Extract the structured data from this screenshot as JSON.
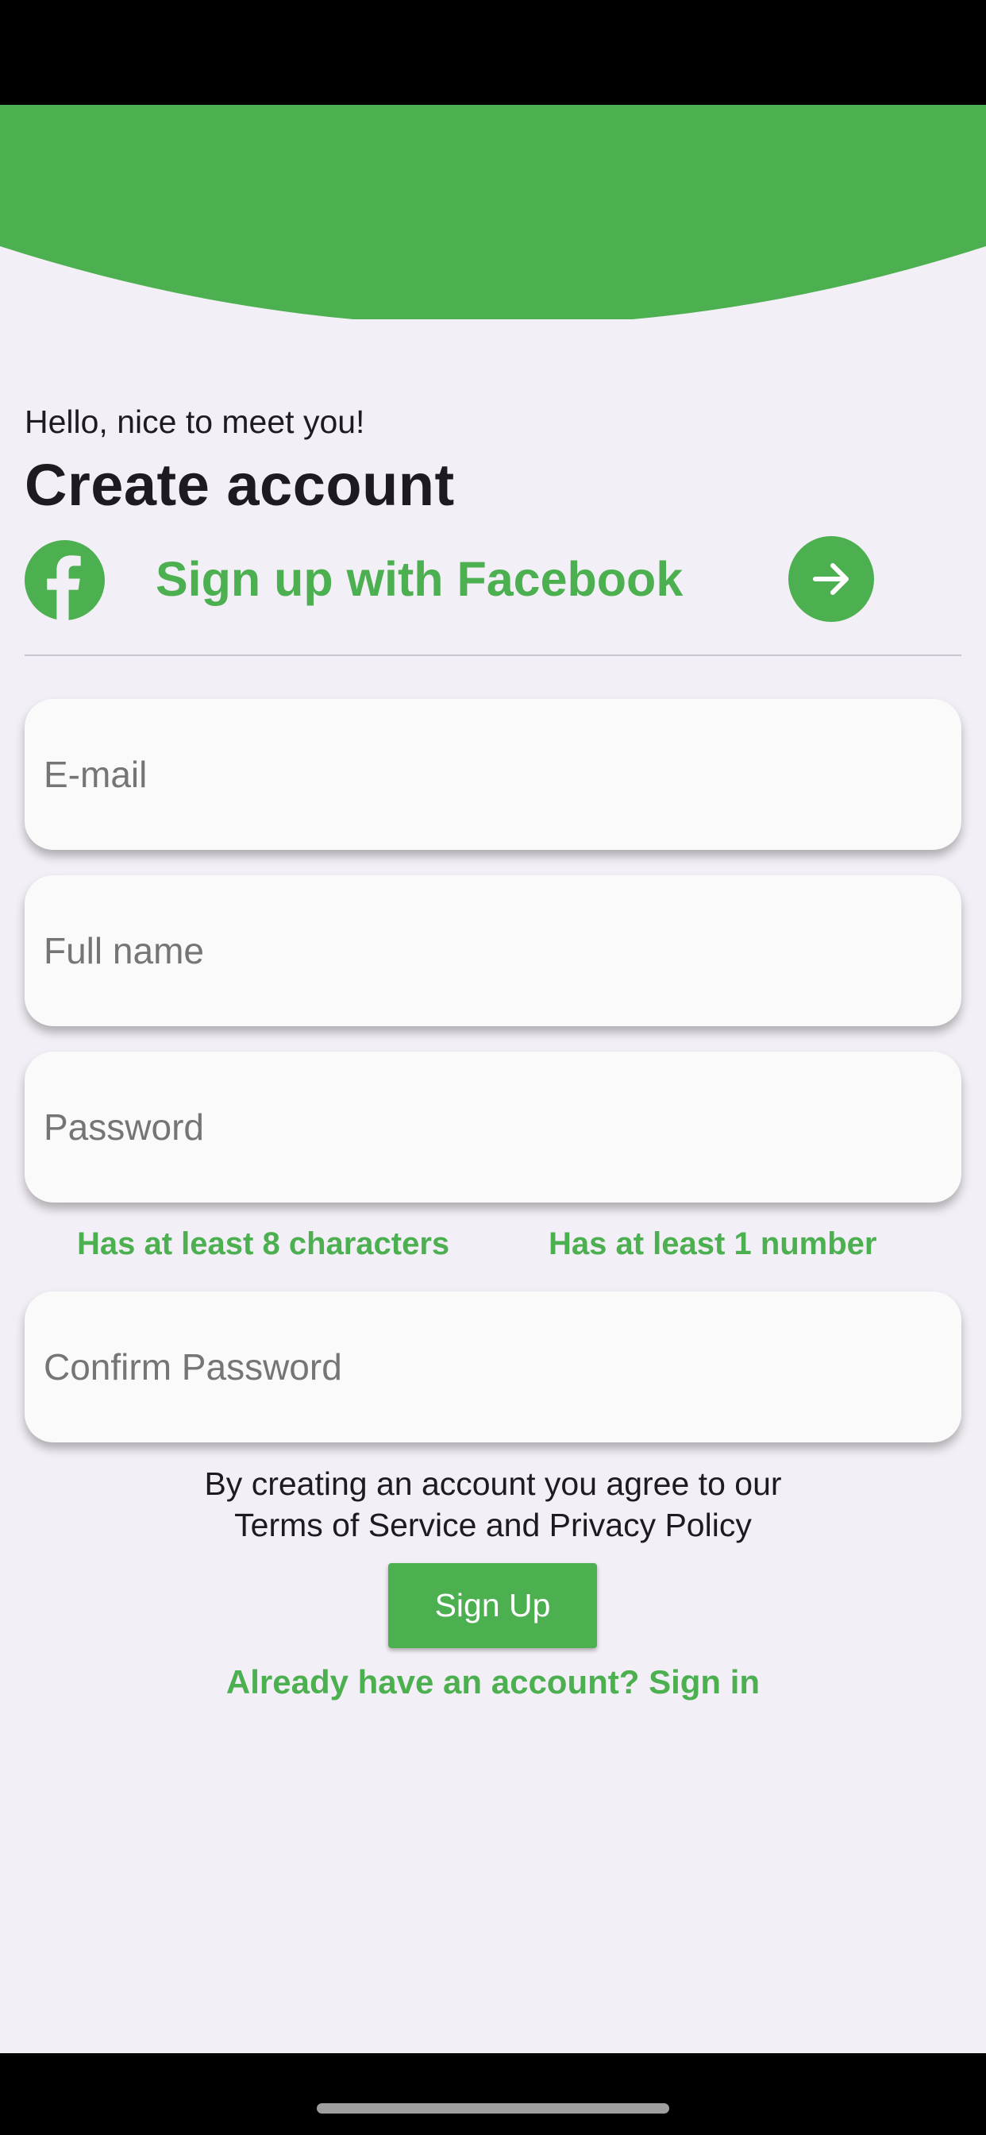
{
  "colors": {
    "accent": "#4caf50",
    "background": "#f3eff6",
    "field": "#fafafa"
  },
  "header": {
    "greeting": "Hello, nice to meet you!",
    "title": "Create account"
  },
  "facebook": {
    "label": "Sign up with Facebook",
    "icon": "facebook-icon",
    "arrow_icon": "arrow-right-icon"
  },
  "form": {
    "email_placeholder": "E-mail",
    "email_value": "",
    "fullname_placeholder": "Full name",
    "fullname_value": "",
    "password_placeholder": "Password",
    "password_value": "",
    "password_hints": [
      "Has at least 8 characters",
      "Has at least 1 number"
    ],
    "confirm_placeholder": "Confirm Password",
    "confirm_value": ""
  },
  "terms": {
    "line1": "By creating an account you agree to our",
    "line2": "Terms of Service and Privacy Policy"
  },
  "signup_button": "Sign Up",
  "signin_link": "Already have an account? Sign in"
}
